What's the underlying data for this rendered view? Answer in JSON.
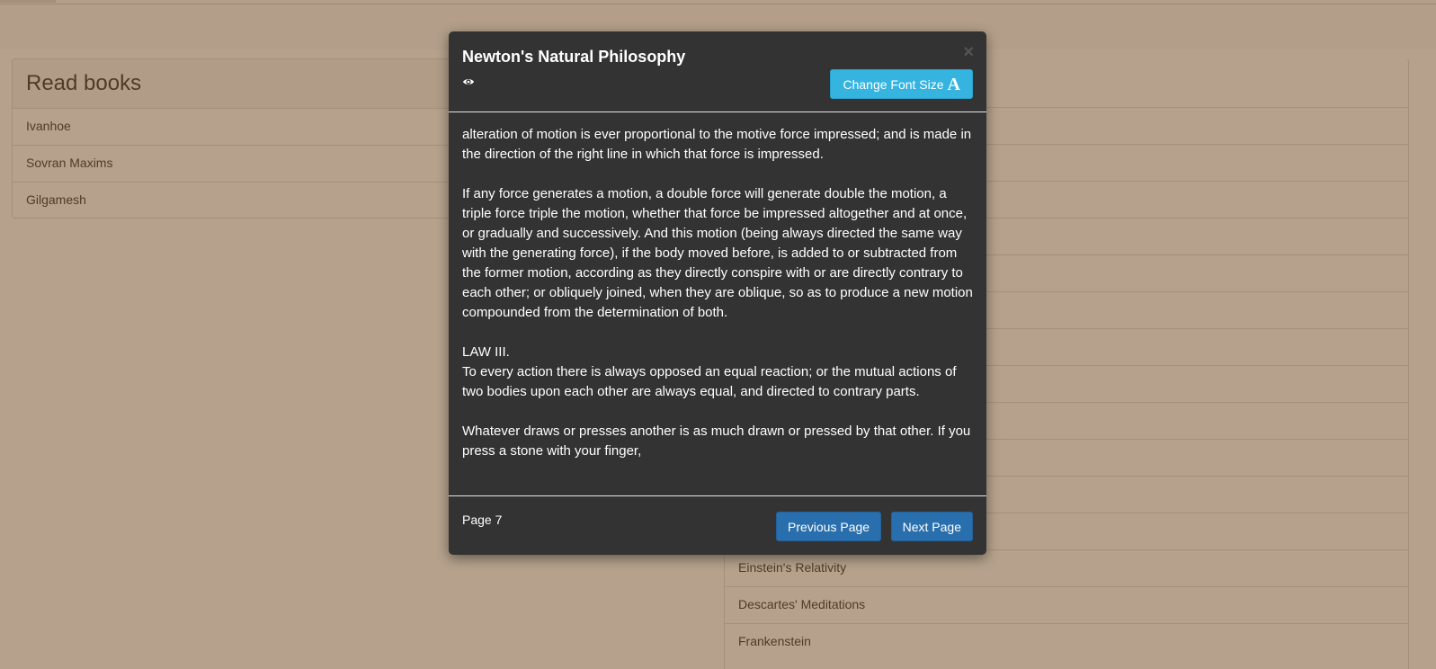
{
  "read_panel": {
    "title": "Read books",
    "items": [
      "Ivanhoe",
      "Sovran Maxims",
      "Gilgamesh"
    ]
  },
  "unread_panel": {
    "items": [
      "",
      "",
      "",
      "",
      "",
      "",
      "",
      "",
      "",
      "",
      "",
      "",
      "Einstein's Relativity",
      "Descartes' Meditations",
      "Frankenstein"
    ]
  },
  "modal": {
    "title": "Newton's Natural Philosophy",
    "eye_icon": "eye-icon",
    "font_button_label": "Change Font Size",
    "font_button_icon": "A",
    "close_icon": "×",
    "body_text": "alteration of motion is ever proportional to the motive force impressed; and is made in the direction of the right line in which that force is impressed.\n\nIf any force generates a motion, a double force will generate double the motion, a triple force triple the motion, whether that force be impressed altogether and at once, or gradually and successively. And this motion (being always directed the same way with the generating force), if the body moved before, is added to or subtracted from the former motion, according as they directly conspire with or are directly contrary to each other; or obliquely joined, when they are oblique, so as to produce a new motion compounded from the determination of both.\n\nLAW III.\nTo every action there is always opposed an equal reaction; or the mutual actions of two bodies upon each other are always equal, and directed to contrary parts.\n\nWhatever draws or presses another is as much drawn or pressed by that other. If you press a stone with your finger,",
    "page_label": "Page 7",
    "prev_label": "Previous Page",
    "next_label": "Next Page"
  },
  "colors": {
    "overlay": "#6e4619",
    "modal_bg": "#333333",
    "font_button": "#34b4df",
    "nav_button": "#2a6fad"
  }
}
